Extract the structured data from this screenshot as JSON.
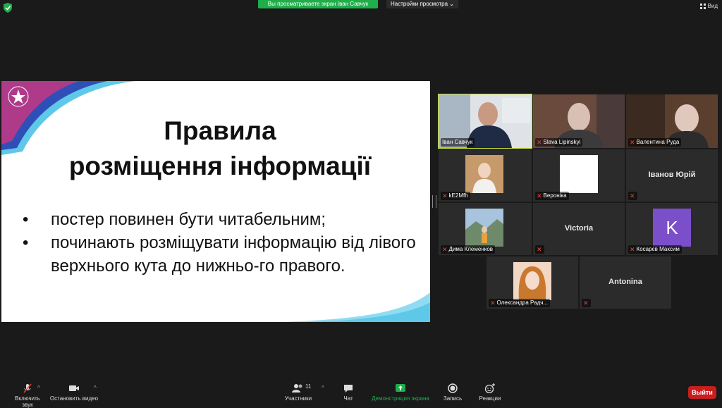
{
  "top_bar": {
    "share_banner": "Вы просматриваете экран Іван Савчук",
    "view_options": "Настройки просмотра",
    "view_options_caret": "⌄",
    "view_label": "Вид",
    "accent": "#1fae4a"
  },
  "slide": {
    "title_line1": "Правила",
    "title_line2": "розміщення інформації",
    "bullets": [
      "постер повинен бути читабельним;",
      "починають розміщувати інформацію від лівого верхнього кута до нижньо-го правого."
    ]
  },
  "participants": [
    {
      "name": "Іван Савчук",
      "muted": false,
      "active": true
    },
    {
      "name": "Slava Lipinskyi",
      "muted": true
    },
    {
      "name": "Валентина Руда",
      "muted": true
    },
    {
      "name": "kE2Mfh",
      "muted": true
    },
    {
      "name": "Вероніка",
      "muted": true
    },
    {
      "name": "Іванов Юрій",
      "muted": true
    },
    {
      "name": "Дима Клеменков",
      "muted": true
    },
    {
      "name": "Victoria",
      "muted": true
    },
    {
      "name": "Косарєв Максим",
      "muted": true,
      "avatar_letter": "K",
      "avatar_color": "#7b4fc9"
    },
    {
      "name": "Олександра Радч...",
      "muted": true
    },
    {
      "name": "Antonina",
      "muted": true
    }
  ],
  "toolbar": {
    "mute_label": "Включить звук",
    "video_label": "Остановить видео",
    "participants_label": "Участники",
    "participants_count": "11",
    "chat_label": "Чат",
    "share_label": "Демонстрация экрана",
    "record_label": "Запись",
    "reactions_label": "Реакции",
    "leave_label": "Выйти",
    "leave_color": "#c81e1e",
    "share_color": "#1fae4a"
  }
}
